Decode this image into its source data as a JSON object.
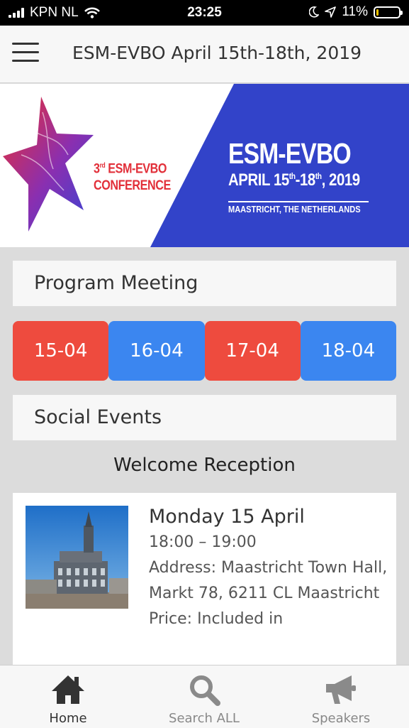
{
  "status_bar": {
    "carrier": "KPN NL",
    "time": "23:25",
    "battery": "11%",
    "battery_level": 0.11
  },
  "header": {
    "title": "ESM-EVBO April 15th-18th, 2019"
  },
  "banner": {
    "conference_ordinal": "3",
    "conference_ordinal_suffix": "rd",
    "conference_line1": "ESM-EVBO",
    "conference_line2": "CONFERENCE",
    "title": "ESM-EVBO",
    "dates_prefix": "APRIL 15",
    "dates_sup1": "th",
    "dates_mid": "-18",
    "dates_sup2": "th",
    "dates_suffix": ", 2019",
    "location": "MAASTRICHT, THE NETHERLANDS"
  },
  "program": {
    "heading": "Program Meeting",
    "dates": [
      "15-04",
      "16-04",
      "17-04",
      "18-04"
    ]
  },
  "social": {
    "heading": "Social Events",
    "event_title": "Welcome Reception",
    "event": {
      "day": "Monday 15 April",
      "time": "18:00 – 19:00",
      "address": "Address: Maastricht Town Hall, Markt 78, 6211 CL Maastricht",
      "price": "Price: Included in"
    }
  },
  "tabs": [
    {
      "label": "Home",
      "icon": "home-icon"
    },
    {
      "label": "Search ALL",
      "icon": "search-icon"
    },
    {
      "label": "Speakers",
      "icon": "megaphone-icon"
    }
  ],
  "colors": {
    "date_red": "#ee4b3e",
    "date_blue": "#3b86f0",
    "banner_blue": "#3243c9",
    "brand_red": "#e2303a"
  }
}
